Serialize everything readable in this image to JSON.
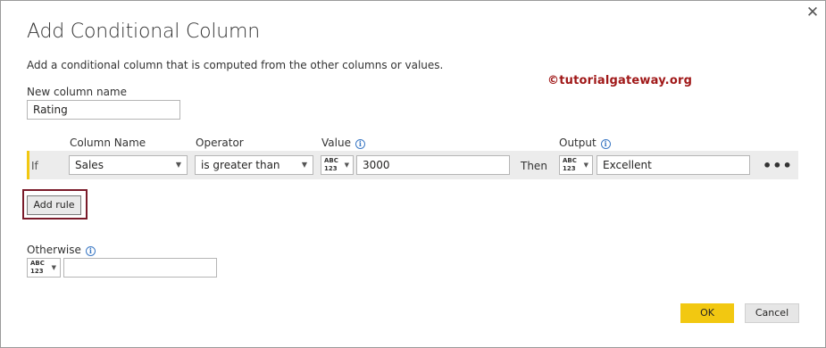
{
  "dialog": {
    "title": "Add Conditional Column",
    "subtitle": "Add a conditional column that is computed from the other columns or values.",
    "close_glyph": "✕"
  },
  "watermark": "©tutorialgateway.org",
  "new_column": {
    "label": "New column name",
    "value": "Rating"
  },
  "headers": {
    "column_name": "Column Name",
    "operator": "Operator",
    "value": "Value",
    "output": "Output"
  },
  "rule": {
    "if_label": "If",
    "column": "Sales",
    "operator": "is greater than",
    "value_type_top": "ABC",
    "value_type_bottom": "123",
    "value": "3000",
    "then_label": "Then",
    "output_type_top": "ABC",
    "output_type_bottom": "123",
    "output": "Excellent",
    "more_glyph": "•••"
  },
  "add_rule_label": "Add rule",
  "otherwise": {
    "label": "Otherwise",
    "type_top": "ABC",
    "type_bottom": "123",
    "value": ""
  },
  "buttons": {
    "ok": "OK",
    "cancel": "Cancel"
  },
  "colors": {
    "accent": "#f2c811",
    "highlight_border": "#7a1b2a",
    "info_icon": "#3b78c4",
    "watermark": "#a01818"
  }
}
